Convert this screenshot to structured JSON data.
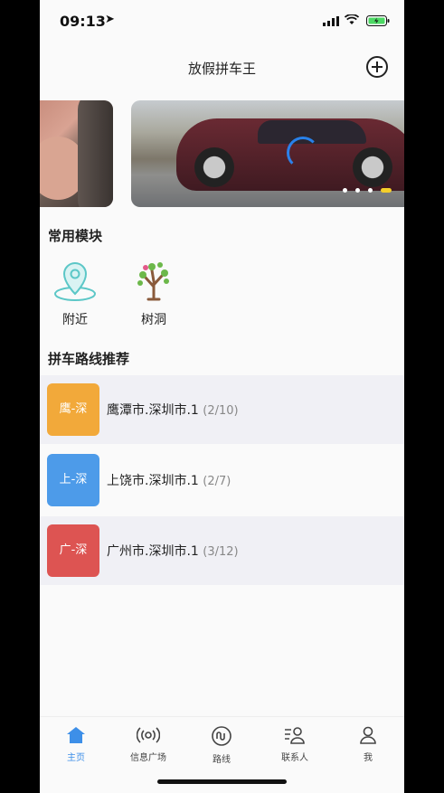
{
  "status_bar": {
    "time": "09:13",
    "location_icon": "location-arrow-icon",
    "battery_color": "#4cd964"
  },
  "nav": {
    "title": "放假拼车王",
    "add_icon": "add-circle-icon"
  },
  "banner": {
    "page_count": 4,
    "active_page": 4,
    "active_dot_color": "#f5cf2a"
  },
  "modules": {
    "title": "常用模块",
    "items": [
      {
        "label": "附近",
        "icon": "map-pin-icon"
      },
      {
        "label": "树洞",
        "icon": "tree-icon"
      }
    ]
  },
  "routes": {
    "title": "拼车路线推荐",
    "items": [
      {
        "badge": "鹰-深",
        "badge_color": "#f2a93a",
        "name": "鹰潭市.深圳市.1",
        "count": "(2/10)"
      },
      {
        "badge": "上-深",
        "badge_color": "#4d9be9",
        "name": "上饶市.深圳市.1",
        "count": "(2/7)"
      },
      {
        "badge": "广-深",
        "badge_color": "#dd5452",
        "name": "广州市.深圳市.1",
        "count": "(3/12)"
      }
    ]
  },
  "tabbar": {
    "active_color": "#3d8fe8",
    "items": [
      {
        "label": "主页",
        "icon": "home-icon"
      },
      {
        "label": "信息广场",
        "icon": "broadcast-icon"
      },
      {
        "label": "路线",
        "icon": "route-icon"
      },
      {
        "label": "联系人",
        "icon": "contacts-icon"
      },
      {
        "label": "我",
        "icon": "user-icon"
      }
    ]
  }
}
